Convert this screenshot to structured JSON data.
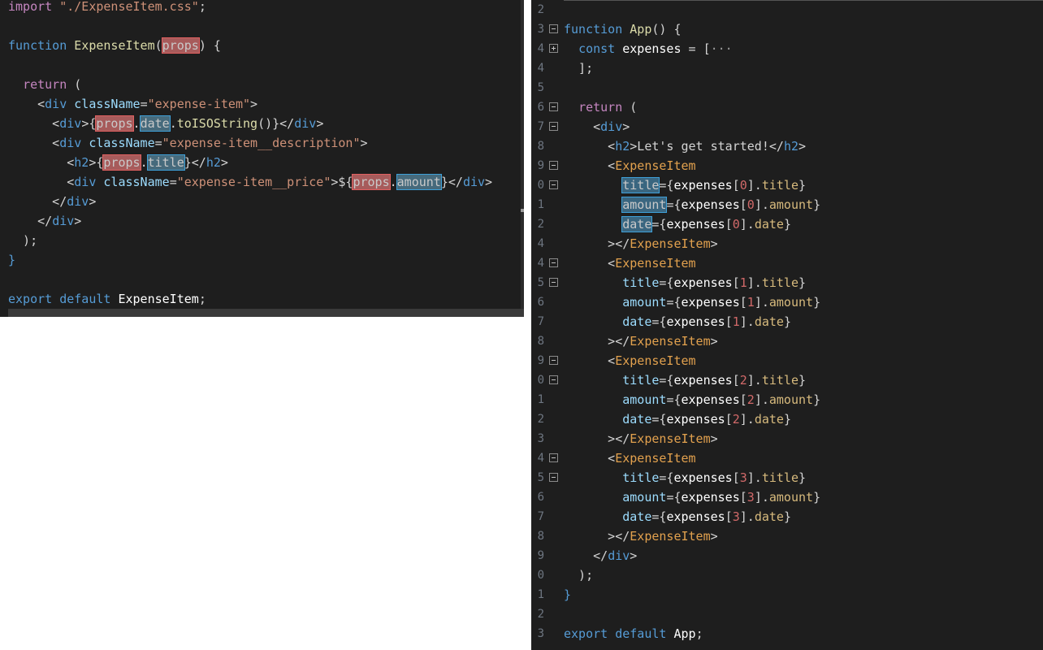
{
  "left_editor": {
    "lines": [
      {
        "t": [
          [
            "str2",
            "import "
          ],
          [
            "str",
            "\"./ExpenseItem.css\""
          ],
          [
            "p",
            ";"
          ]
        ]
      },
      {
        "t": []
      },
      {
        "t": [
          [
            "kw",
            "function "
          ],
          [
            "fn",
            "ExpenseItem"
          ],
          [
            "p",
            "("
          ],
          [
            "hlr",
            "props"
          ],
          [
            "p",
            ") {"
          ]
        ]
      },
      {
        "t": []
      },
      {
        "t": [
          [
            "p",
            "  "
          ],
          [
            "kw2",
            "return "
          ],
          [
            "p",
            "("
          ]
        ]
      },
      {
        "t": [
          [
            "p",
            "    <"
          ],
          [
            "tagb",
            "div "
          ],
          [
            "attr",
            "className"
          ],
          [
            "p",
            "="
          ],
          [
            "str",
            "\"expense-item\""
          ],
          [
            "p",
            ">"
          ]
        ]
      },
      {
        "t": [
          [
            "p",
            "      <"
          ],
          [
            "tagb",
            "div"
          ],
          [
            "p",
            ">{"
          ],
          [
            "hlr",
            "props"
          ],
          [
            "p",
            "."
          ],
          [
            "hlb",
            "date"
          ],
          [
            "p",
            "."
          ],
          [
            "fn",
            "toISOString"
          ],
          [
            "p",
            "()}</"
          ],
          [
            "tagb",
            "div"
          ],
          [
            "p",
            ">"
          ]
        ]
      },
      {
        "t": [
          [
            "p",
            "      <"
          ],
          [
            "tagb",
            "div "
          ],
          [
            "attr",
            "className"
          ],
          [
            "p",
            "="
          ],
          [
            "str",
            "\"expense-item__description\""
          ],
          [
            "p",
            ">"
          ]
        ]
      },
      {
        "t": [
          [
            "p",
            "        <"
          ],
          [
            "tagb",
            "h2"
          ],
          [
            "p",
            ">{"
          ],
          [
            "hlr",
            "props"
          ],
          [
            "p",
            "."
          ],
          [
            "hlb",
            "title"
          ],
          [
            "p",
            "}</"
          ],
          [
            "tagb",
            "h2"
          ],
          [
            "p",
            ">"
          ]
        ]
      },
      {
        "t": [
          [
            "p",
            "        <"
          ],
          [
            "tagb",
            "div "
          ],
          [
            "attr",
            "className"
          ],
          [
            "p",
            "="
          ],
          [
            "str",
            "\"expense-item__price\""
          ],
          [
            "p",
            ">${"
          ],
          [
            "hlr",
            "props"
          ],
          [
            "p",
            "."
          ],
          [
            "hlb",
            "amount"
          ],
          [
            "p",
            "}</"
          ],
          [
            "tagb",
            "div"
          ],
          [
            "p",
            ">"
          ]
        ]
      },
      {
        "t": [
          [
            "p",
            "      </"
          ],
          [
            "tagb",
            "div"
          ],
          [
            "p",
            ">"
          ]
        ]
      },
      {
        "t": [
          [
            "p",
            "    </"
          ],
          [
            "tagb",
            "div"
          ],
          [
            "p",
            ">"
          ]
        ]
      },
      {
        "t": [
          [
            "p",
            "  );"
          ]
        ]
      },
      {
        "t": [
          [
            "kw",
            "}"
          ]
        ]
      },
      {
        "t": []
      },
      {
        "t": [
          [
            "kw",
            "export "
          ],
          [
            "kw",
            "default "
          ],
          [
            "var",
            "ExpenseItem"
          ],
          [
            "p",
            ";"
          ]
        ]
      }
    ]
  },
  "right_editor": {
    "lines": [
      {
        "n": "2",
        "fold": "",
        "t": []
      },
      {
        "n": "3",
        "fold": "minus",
        "t": [
          [
            "kw",
            "function "
          ],
          [
            "fn",
            "App"
          ],
          [
            "p",
            "() {"
          ]
        ]
      },
      {
        "n": "4",
        "fold": "plus",
        "t": [
          [
            "p",
            "  "
          ],
          [
            "kw",
            "const "
          ],
          [
            "var",
            "expenses"
          ],
          [
            "p",
            " = ["
          ],
          [
            "dots",
            "···"
          ]
        ]
      },
      {
        "n": "4",
        "fold": "",
        "t": [
          [
            "p",
            "  ];"
          ]
        ]
      },
      {
        "n": "5",
        "fold": "",
        "t": []
      },
      {
        "n": "6",
        "fold": "minus",
        "t": [
          [
            "p",
            "  "
          ],
          [
            "kw2",
            "return "
          ],
          [
            "p",
            "("
          ]
        ]
      },
      {
        "n": "7",
        "fold": "minus",
        "t": [
          [
            "p",
            "    <"
          ],
          [
            "tagb",
            "div"
          ],
          [
            "p",
            ">"
          ]
        ]
      },
      {
        "n": "8",
        "fold": "",
        "t": [
          [
            "p",
            "      <"
          ],
          [
            "tagb",
            "h2"
          ],
          [
            "p",
            ">Let's get started!</"
          ],
          [
            "tagb",
            "h2"
          ],
          [
            "p",
            ">"
          ]
        ]
      },
      {
        "n": "9",
        "fold": "minus",
        "t": [
          [
            "p",
            "      <"
          ],
          [
            "comp",
            "ExpenseItem"
          ]
        ]
      },
      {
        "n": "0",
        "fold": "minus",
        "t": [
          [
            "p",
            "        "
          ],
          [
            "hlb2",
            "title"
          ],
          [
            "p",
            "={"
          ],
          [
            "var",
            "expenses"
          ],
          [
            "p",
            "["
          ],
          [
            "num",
            "0"
          ],
          [
            "p",
            "]."
          ],
          [
            "prop",
            "title"
          ],
          [
            "p",
            "}"
          ]
        ]
      },
      {
        "n": "1",
        "fold": "",
        "t": [
          [
            "p",
            "        "
          ],
          [
            "hlb2",
            "amount"
          ],
          [
            "p",
            "={"
          ],
          [
            "var",
            "expenses"
          ],
          [
            "p",
            "["
          ],
          [
            "num",
            "0"
          ],
          [
            "p",
            "]."
          ],
          [
            "prop",
            "amount"
          ],
          [
            "p",
            "}"
          ]
        ]
      },
      {
        "n": "2",
        "fold": "",
        "t": [
          [
            "p",
            "        "
          ],
          [
            "hlb2",
            "date"
          ],
          [
            "p",
            "={"
          ],
          [
            "var",
            "expenses"
          ],
          [
            "p",
            "["
          ],
          [
            "num",
            "0"
          ],
          [
            "p",
            "]."
          ],
          [
            "prop",
            "date"
          ],
          [
            "p",
            "}"
          ]
        ]
      },
      {
        "n": "4",
        "fold": "",
        "t": [
          [
            "p",
            "      ></"
          ],
          [
            "comp",
            "ExpenseItem"
          ],
          [
            "p",
            ">"
          ]
        ]
      },
      {
        "n": "4",
        "fold": "minus",
        "t": [
          [
            "p",
            "      <"
          ],
          [
            "comp",
            "ExpenseItem"
          ]
        ]
      },
      {
        "n": "5",
        "fold": "minus",
        "t": [
          [
            "p",
            "        "
          ],
          [
            "pl",
            "title"
          ],
          [
            "p",
            "={"
          ],
          [
            "var",
            "expenses"
          ],
          [
            "p",
            "["
          ],
          [
            "num",
            "1"
          ],
          [
            "p",
            "]."
          ],
          [
            "prop",
            "title"
          ],
          [
            "p",
            "}"
          ]
        ]
      },
      {
        "n": "6",
        "fold": "",
        "t": [
          [
            "p",
            "        "
          ],
          [
            "pl",
            "amount"
          ],
          [
            "p",
            "={"
          ],
          [
            "var",
            "expenses"
          ],
          [
            "p",
            "["
          ],
          [
            "num",
            "1"
          ],
          [
            "p",
            "]."
          ],
          [
            "prop",
            "amount"
          ],
          [
            "p",
            "}"
          ]
        ]
      },
      {
        "n": "7",
        "fold": "",
        "t": [
          [
            "p",
            "        "
          ],
          [
            "pl",
            "date"
          ],
          [
            "p",
            "={"
          ],
          [
            "var",
            "expenses"
          ],
          [
            "p",
            "["
          ],
          [
            "num",
            "1"
          ],
          [
            "p",
            "]."
          ],
          [
            "prop",
            "date"
          ],
          [
            "p",
            "}"
          ]
        ]
      },
      {
        "n": "8",
        "fold": "",
        "t": [
          [
            "p",
            "      ></"
          ],
          [
            "comp",
            "ExpenseItem"
          ],
          [
            "p",
            ">"
          ]
        ]
      },
      {
        "n": "9",
        "fold": "minus",
        "t": [
          [
            "p",
            "      <"
          ],
          [
            "comp",
            "ExpenseItem"
          ]
        ]
      },
      {
        "n": "0",
        "fold": "minus",
        "t": [
          [
            "p",
            "        "
          ],
          [
            "pl",
            "title"
          ],
          [
            "p",
            "={"
          ],
          [
            "var",
            "expenses"
          ],
          [
            "p",
            "["
          ],
          [
            "num",
            "2"
          ],
          [
            "p",
            "]."
          ],
          [
            "prop",
            "title"
          ],
          [
            "p",
            "}"
          ]
        ]
      },
      {
        "n": "1",
        "fold": "",
        "t": [
          [
            "p",
            "        "
          ],
          [
            "pl",
            "amount"
          ],
          [
            "p",
            "={"
          ],
          [
            "var",
            "expenses"
          ],
          [
            "p",
            "["
          ],
          [
            "num",
            "2"
          ],
          [
            "p",
            "]."
          ],
          [
            "prop",
            "amount"
          ],
          [
            "p",
            "}"
          ]
        ]
      },
      {
        "n": "2",
        "fold": "",
        "t": [
          [
            "p",
            "        "
          ],
          [
            "pl",
            "date"
          ],
          [
            "p",
            "={"
          ],
          [
            "var",
            "expenses"
          ],
          [
            "p",
            "["
          ],
          [
            "num",
            "2"
          ],
          [
            "p",
            "]."
          ],
          [
            "prop",
            "date"
          ],
          [
            "p",
            "}"
          ]
        ]
      },
      {
        "n": "3",
        "fold": "",
        "t": [
          [
            "p",
            "      ></"
          ],
          [
            "comp",
            "ExpenseItem"
          ],
          [
            "p",
            ">"
          ]
        ]
      },
      {
        "n": "4",
        "fold": "minus",
        "t": [
          [
            "p",
            "      <"
          ],
          [
            "comp",
            "ExpenseItem"
          ]
        ]
      },
      {
        "n": "5",
        "fold": "minus",
        "t": [
          [
            "p",
            "        "
          ],
          [
            "pl",
            "title"
          ],
          [
            "p",
            "={"
          ],
          [
            "var",
            "expenses"
          ],
          [
            "p",
            "["
          ],
          [
            "num",
            "3"
          ],
          [
            "p",
            "]."
          ],
          [
            "prop",
            "title"
          ],
          [
            "p",
            "}"
          ]
        ]
      },
      {
        "n": "6",
        "fold": "",
        "t": [
          [
            "p",
            "        "
          ],
          [
            "pl",
            "amount"
          ],
          [
            "p",
            "={"
          ],
          [
            "var",
            "expenses"
          ],
          [
            "p",
            "["
          ],
          [
            "num",
            "3"
          ],
          [
            "p",
            "]."
          ],
          [
            "prop",
            "amount"
          ],
          [
            "p",
            "}"
          ]
        ]
      },
      {
        "n": "7",
        "fold": "",
        "t": [
          [
            "p",
            "        "
          ],
          [
            "pl",
            "date"
          ],
          [
            "p",
            "={"
          ],
          [
            "var",
            "expenses"
          ],
          [
            "p",
            "["
          ],
          [
            "num",
            "3"
          ],
          [
            "p",
            "]."
          ],
          [
            "prop",
            "date"
          ],
          [
            "p",
            "}"
          ]
        ]
      },
      {
        "n": "8",
        "fold": "",
        "t": [
          [
            "p",
            "      ></"
          ],
          [
            "comp",
            "ExpenseItem"
          ],
          [
            "p",
            ">"
          ]
        ]
      },
      {
        "n": "9",
        "fold": "",
        "t": [
          [
            "p",
            "    </"
          ],
          [
            "tagb",
            "div"
          ],
          [
            "p",
            ">"
          ]
        ]
      },
      {
        "n": "0",
        "fold": "",
        "t": [
          [
            "p",
            "  );"
          ]
        ]
      },
      {
        "n": "1",
        "fold": "",
        "t": [
          [
            "kw",
            "}"
          ]
        ]
      },
      {
        "n": "2",
        "fold": "",
        "t": []
      },
      {
        "n": "3",
        "fold": "",
        "t": [
          [
            "kw",
            "export "
          ],
          [
            "kw",
            "default "
          ],
          [
            "var",
            "App"
          ],
          [
            "p",
            ";"
          ]
        ]
      }
    ]
  }
}
